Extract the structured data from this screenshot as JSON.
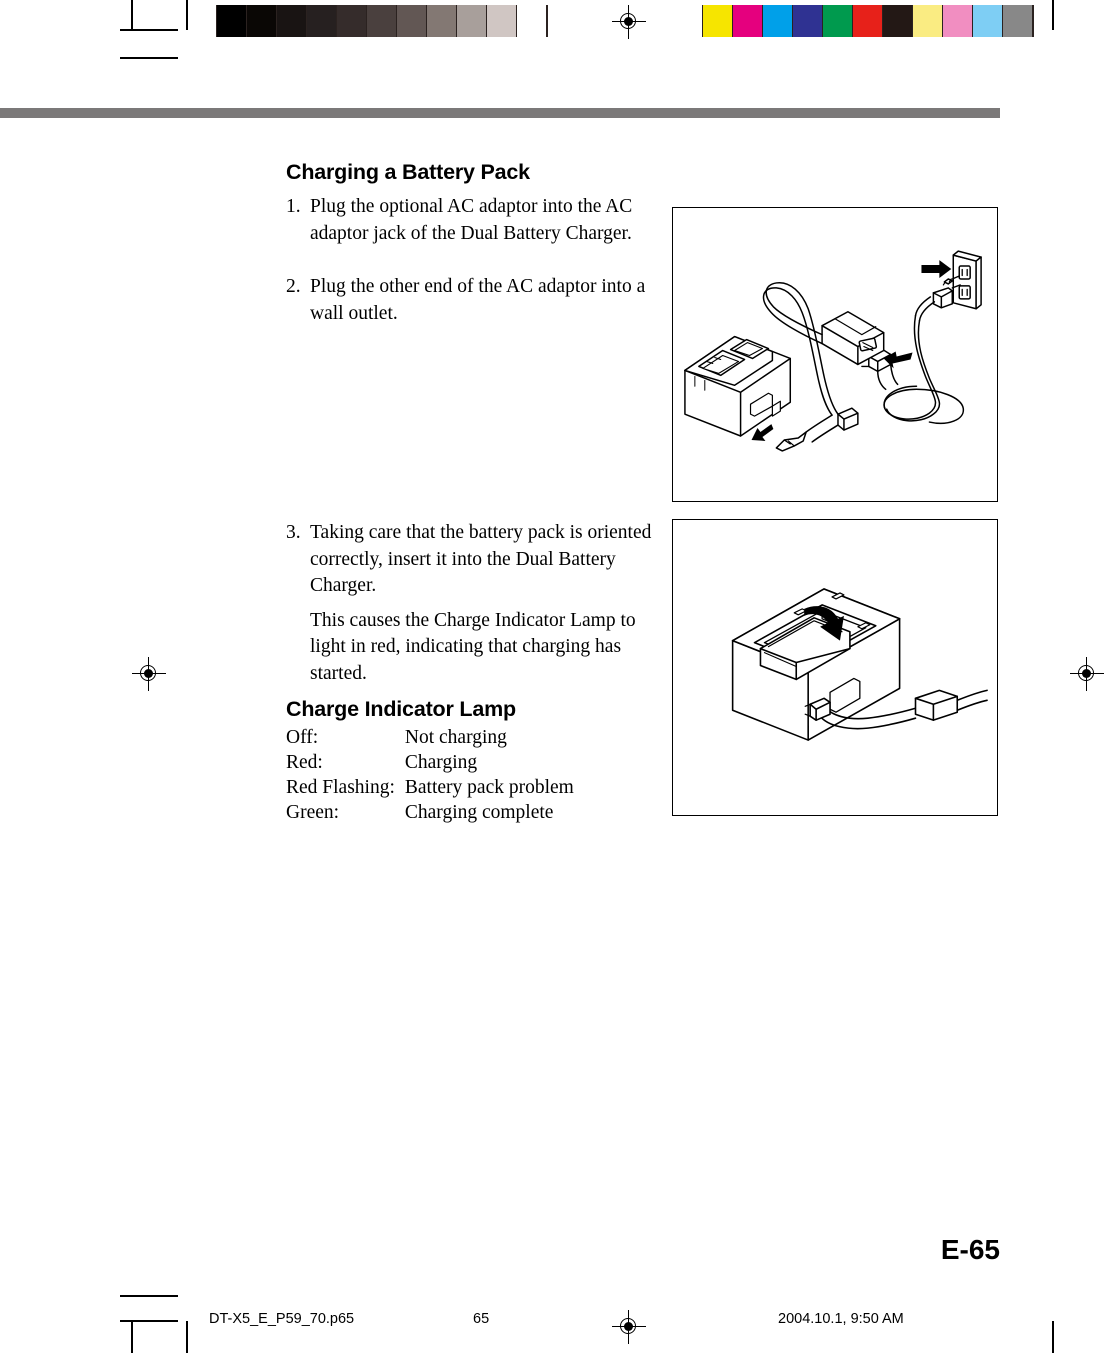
{
  "document": {
    "section_heading": "Charging a Battery Pack",
    "page_label": "E-65"
  },
  "steps": [
    {
      "num": "1.",
      "text": "Plug the optional AC adaptor into the AC adaptor jack of the Dual Battery Charger."
    },
    {
      "num": "2.",
      "text": "Plug the other end of the AC adaptor into a wall outlet."
    },
    {
      "num": "3.",
      "text": "Taking care that the battery pack is oriented correctly, insert it into the Dual Battery Charger."
    }
  ],
  "step3_note": "This causes the Charge Indicator Lamp to light in red, indicating that charging has started.",
  "lamp": {
    "heading": "Charge Indicator Lamp",
    "rows": [
      {
        "state": "Off:",
        "meaning": "Not charging"
      },
      {
        "state": "Red:",
        "meaning": "Charging"
      },
      {
        "state": "Red Flashing:",
        "meaning": "Battery pack problem"
      },
      {
        "state": "Green:",
        "meaning": "Charging complete"
      }
    ]
  },
  "figures": [
    {
      "name": "ac-adaptor-connection-diagram",
      "caption_parts": [
        "Dual Battery Charger",
        "AC adaptor",
        "wall outlet"
      ]
    },
    {
      "name": "battery-insertion-diagram",
      "caption_parts": [
        "Dual Battery Charger",
        "battery pack"
      ]
    }
  ],
  "footer": {
    "file": "DT-X5_E_P59_70.p65",
    "page": "65",
    "date": "2004.10.1, 9:50 AM"
  },
  "calibration": {
    "gray_patches": [
      "#000000",
      "#0a0705",
      "#191413",
      "#262020",
      "#352c2b",
      "#4a403e",
      "#625754",
      "#837873",
      "#a89f9b",
      "#d0c6c3",
      "#ffffff"
    ],
    "color_patches": [
      "#f6e500",
      "#e5007e",
      "#00a0e9",
      "#2f3292",
      "#009a4e",
      "#e7211a",
      "#231815",
      "#faec82",
      "#f18ec1",
      "#7ecef4",
      "#888888"
    ],
    "separator_color": "#2b2220"
  },
  "theme": {
    "header_rule_color": "#7b7979",
    "ink": "#000000",
    "paper": "#ffffff"
  }
}
